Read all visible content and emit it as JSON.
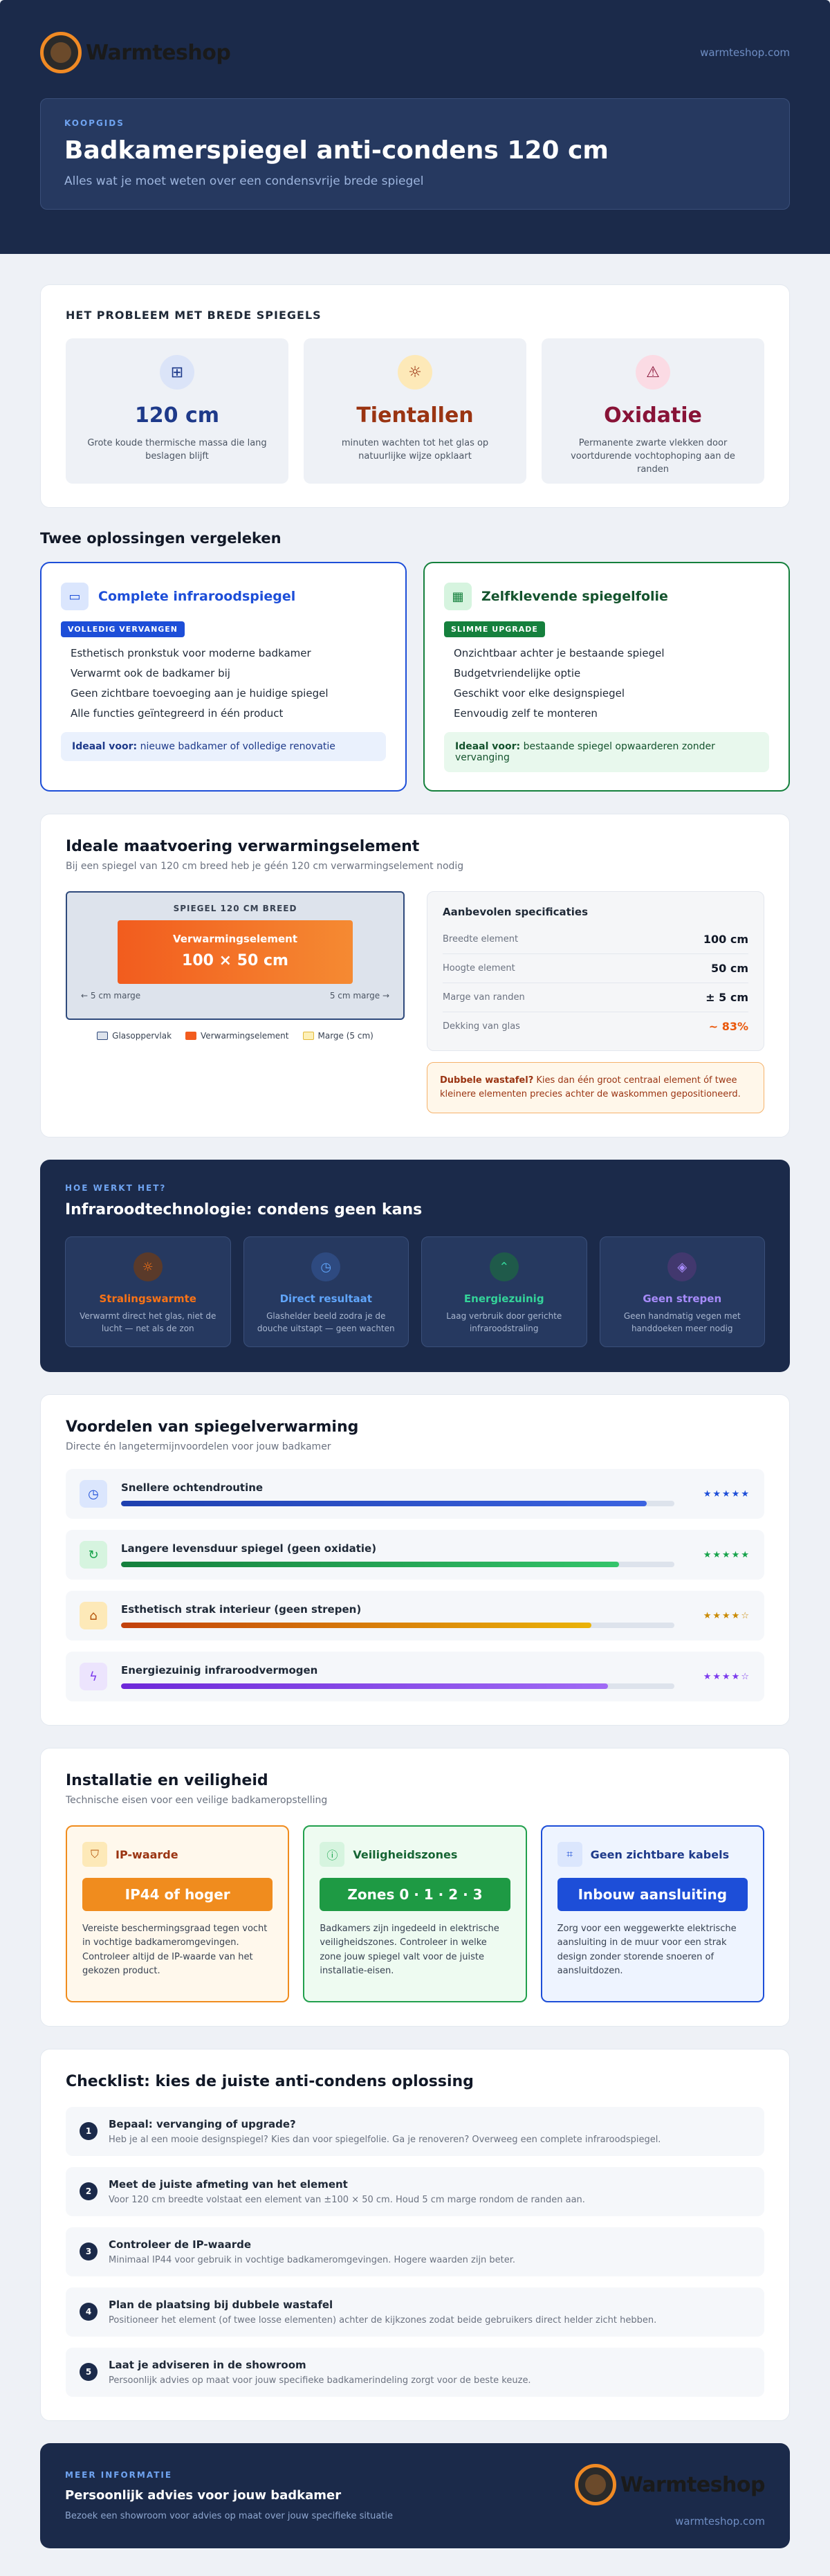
{
  "brand": {
    "name": "Warmteshop",
    "url": "warmteshop.com"
  },
  "hero": {
    "eyebrow": "KOOPGIDS",
    "title": "Badkamerspiegel anti-condens 120 cm",
    "subtitle": "Alles wat je moet weten over een condensvrije brede spiegel"
  },
  "problem": {
    "label": "HET PROBLEEM MET BREDE SPIEGELS",
    "tiles": [
      {
        "value": "120 cm",
        "desc": "Grote koude thermische massa die lang beslagen blijft",
        "icon": "plus-square-icon",
        "color": "#1e3a8a"
      },
      {
        "value": "Tientallen",
        "desc": "minuten wachten tot het glas op natuurlijke wijze opklaart",
        "icon": "sun-icon",
        "color": "#9a3412"
      },
      {
        "value": "Oxidatie",
        "desc": "Permanente zwarte vlekken door voortdurende vochtophoping aan de randen",
        "icon": "warning-icon",
        "color": "#881337"
      }
    ]
  },
  "compare": {
    "title": "Twee oplossingen vergeleken",
    "options": [
      {
        "title": "Complete infraroodspiegel",
        "badge": "VOLLEDIG VERVANGEN",
        "items": [
          "Esthetisch pronkstuk voor moderne badkamer",
          "Verwarmt ook de badkamer bij",
          "Geen zichtbare toevoeging aan je huidige spiegel",
          "Alle functies geïntegreerd in één product"
        ],
        "ideal_label": "Ideaal voor:",
        "ideal_text": "nieuwe badkamer of volledige renovatie",
        "color": "#1d4ed8"
      },
      {
        "title": "Zelfklevende spiegelfolie",
        "badge": "SLIMME UPGRADE",
        "items": [
          "Onzichtbaar achter je bestaande spiegel",
          "Budgetvriendelijke optie",
          "Geschikt voor elke designspiegel",
          "Eenvoudig zelf te monteren"
        ],
        "ideal_label": "Ideaal voor:",
        "ideal_text": "bestaande spiegel opwaarderen zonder vervanging",
        "color": "#15803d"
      }
    ]
  },
  "dimensions": {
    "title": "Ideale maatvoering verwarmingselement",
    "subtitle": "Bij een spiegel van 120 cm breed heb je géén 120 cm verwarmingselement nodig",
    "mirror_label": "SPIEGEL 120 CM BREED",
    "heater_label": "Verwarmingselement",
    "heater_size": "100 × 50 cm",
    "margin_left": "← 5 cm marge",
    "margin_right": "5 cm marge →",
    "legend": [
      "Glasoppervlak",
      "Verwarmingselement",
      "Marge (5 cm)"
    ],
    "spec_title": "Aanbevolen specificaties",
    "specs": [
      {
        "label": "Breedte element",
        "value": "100 cm"
      },
      {
        "label": "Hoogte element",
        "value": "50 cm"
      },
      {
        "label": "Marge van randen",
        "value": "± 5 cm"
      },
      {
        "label": "Dekking van glas",
        "value": "~ 83%"
      }
    ],
    "warn_bold": "Dubbele wastafel?",
    "warn_text": " Kies dan één groot centraal element óf twee kleinere elementen precies achter de waskommen gepositioneerd."
  },
  "tech": {
    "eyebrow": "HOE WERKT HET?",
    "title": "Infraroodtechnologie: condens geen kans",
    "items": [
      {
        "title": "Stralingswarmte",
        "desc": "Verwarmt direct het glas, niet de lucht — net als de zon",
        "icon": "sun-icon",
        "color": "#f97316"
      },
      {
        "title": "Direct resultaat",
        "desc": "Glashelder beeld zodra je de douche uitstapt — geen wachten",
        "icon": "clock-icon",
        "color": "#60a5fa"
      },
      {
        "title": "Energiezuinig",
        "desc": "Laag verbruik door gerichte infraroodstraling",
        "icon": "signal-icon",
        "color": "#34d399"
      },
      {
        "title": "Geen strepen",
        "desc": "Geen handmatig vegen met handdoeken meer nodig",
        "icon": "layers-icon",
        "color": "#a78bfa"
      }
    ]
  },
  "benefits": {
    "title": "Voordelen van spiegelverwarming",
    "subtitle": "Directe én langetermijnvoordelen voor jouw badkamer",
    "items": [
      {
        "title": "Snellere ochtendroutine",
        "score": 0.95,
        "stars": "★★★★★",
        "icon": "clock-icon",
        "color": "#1d4ed8"
      },
      {
        "title": "Langere levensduur spiegel (geen oxidatie)",
        "score": 0.9,
        "stars": "★★★★★",
        "icon": "refresh-icon",
        "color": "#16a34a"
      },
      {
        "title": "Esthetisch strak interieur (geen strepen)",
        "score": 0.85,
        "stars": "★★★★☆",
        "icon": "home-icon",
        "color": "#ca8a04"
      },
      {
        "title": "Energiezuinig infraroodvermogen",
        "score": 0.88,
        "stars": "★★★★☆",
        "icon": "bolt-icon",
        "color": "#7c3aed"
      }
    ]
  },
  "install": {
    "title": "Installatie en veiligheid",
    "subtitle": "Technische eisen voor een veilige badkameropstelling",
    "items": [
      {
        "title": "IP-waarde",
        "pill": "IP44 of hoger",
        "desc": "Vereiste beschermingsgraad tegen vocht in vochtige badkameromgevingen. Controleer altijd de IP-waarde van het gekozen product.",
        "icon": "shield-icon",
        "color": "#ea580c",
        "accent": "#f08c1e",
        "bg": "#fff8ec",
        "text": "#9a3412"
      },
      {
        "title": "Veiligheidszones",
        "pill": "Zones 0 · 1 · 2 · 3",
        "desc": "Badkamers zijn ingedeeld in elektrische veiligheidszones. Controleer in welke zone jouw spiegel valt voor de juiste installatie-eisen.",
        "icon": "alert-circle-icon",
        "color": "#16a34a",
        "accent": "#1e9a44",
        "bg": "#eefbf1",
        "text": "#166534"
      },
      {
        "title": "Geen zichtbare kabels",
        "pill": "Inbouw aansluiting",
        "desc": "Zorg voor een weggewerkte elektrische aansluiting in de muur voor een strak design zonder storende snoeren of aansluitdozen.",
        "icon": "chip-icon",
        "color": "#1d4ed8",
        "accent": "#1d4ed8",
        "bg": "#eef4ff",
        "text": "#1e3a8a"
      }
    ]
  },
  "checklist": {
    "title": "Checklist: kies de juiste anti-condens oplossing",
    "steps": [
      {
        "n": "1",
        "title": "Bepaal: vervanging of upgrade?",
        "desc": "Heb je al een mooie designspiegel? Kies dan voor spiegelfolie. Ga je renoveren? Overweeg een complete infraroodspiegel."
      },
      {
        "n": "2",
        "title": "Meet de juiste afmeting van het element",
        "desc": "Voor 120 cm breedte volstaat een element van ±100 × 50 cm. Houd 5 cm marge rondom de randen aan."
      },
      {
        "n": "3",
        "title": "Controleer de IP-waarde",
        "desc": "Minimaal IP44 voor gebruik in vochtige badkameromgevingen. Hogere waarden zijn beter."
      },
      {
        "n": "4",
        "title": "Plan de plaatsing bij dubbele wastafel",
        "desc": "Positioneer het element (of twee losse elementen) achter de kijkzones zodat beide gebruikers direct helder zicht hebben."
      },
      {
        "n": "5",
        "title": "Laat je adviseren in de showroom",
        "desc": "Persoonlijk advies op maat voor jouw specifieke badkamerindeling zorgt voor de beste keuze."
      }
    ]
  },
  "footer": {
    "eyebrow": "MEER INFORMATIE",
    "title": "Persoonlijk advies voor jouw badkamer",
    "subtitle": "Bezoek een showroom voor advies op maat over jouw specifieke situatie"
  }
}
